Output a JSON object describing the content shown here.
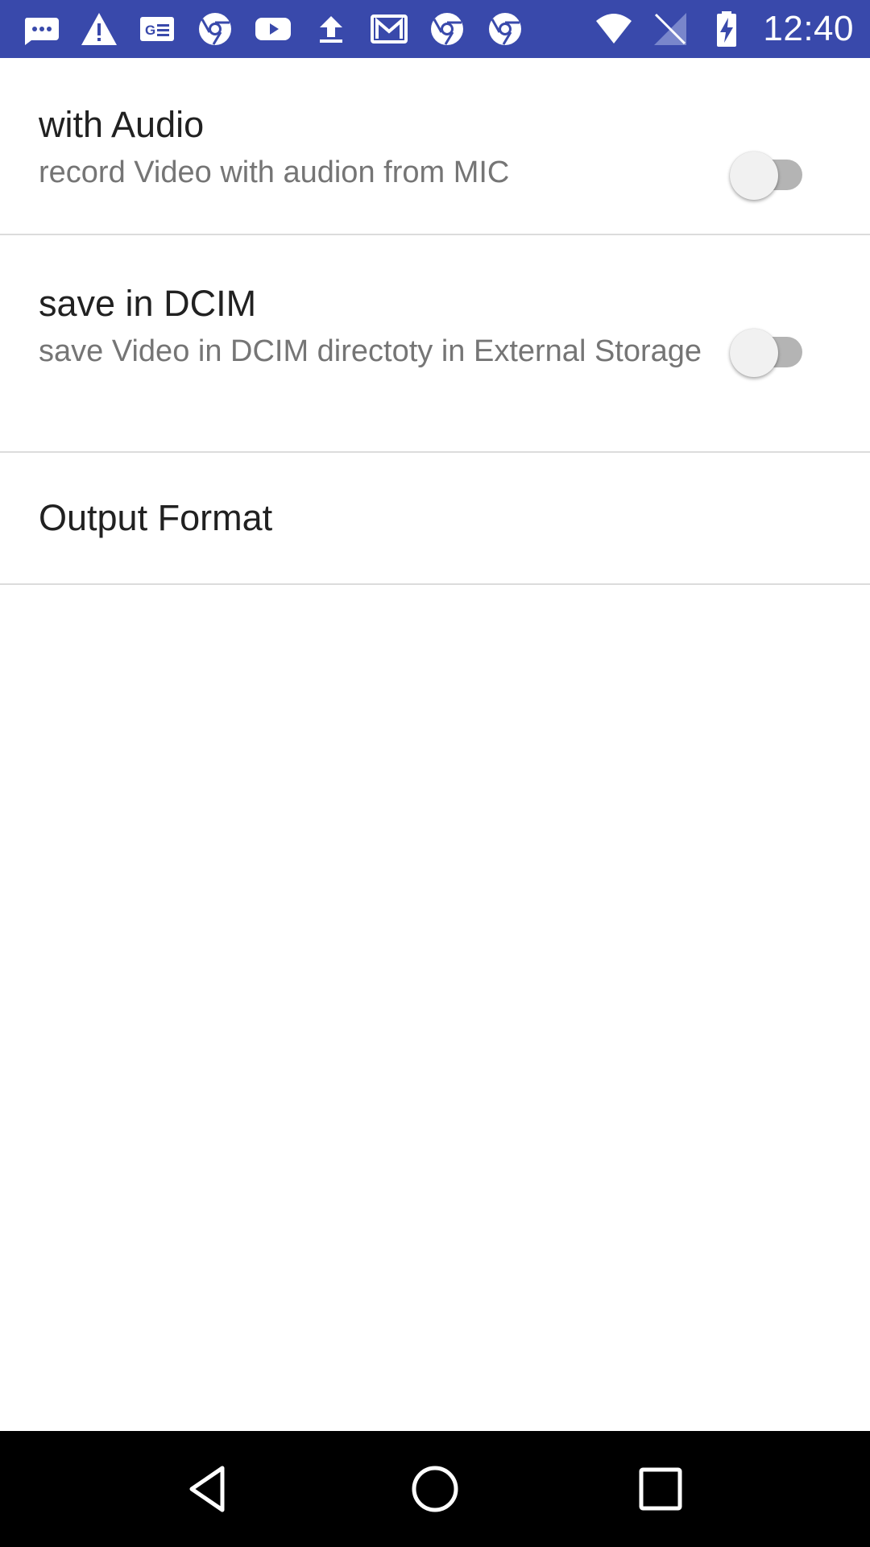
{
  "status_bar": {
    "time": "12:40",
    "background_color": "#3949ab",
    "icons": [
      "messaging-icon",
      "warning-icon",
      "news-icon",
      "chrome-icon",
      "youtube-icon",
      "upload-icon",
      "gmail-icon",
      "chrome-icon",
      "chrome-icon",
      "wifi-icon",
      "no-signal-icon",
      "battery-charging-icon"
    ]
  },
  "preferences": [
    {
      "title": "with Audio",
      "summary": "record Video with audion from MIC",
      "switch_on": false
    },
    {
      "title": "save in DCIM",
      "summary": "save Video in DCIM directoty in External Storage",
      "switch_on": false
    },
    {
      "title": "Output Format"
    }
  ],
  "nav_bar": {
    "buttons": [
      "back-icon",
      "home-icon",
      "recents-icon"
    ]
  }
}
